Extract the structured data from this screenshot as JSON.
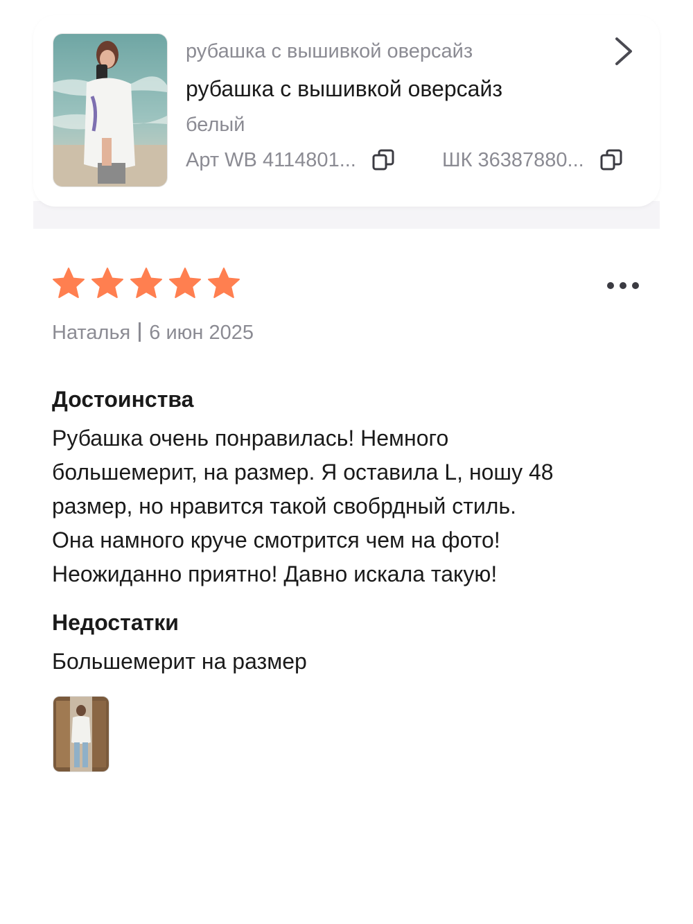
{
  "product": {
    "brand": "рубашка с вышивкой оверсайз",
    "name": "рубашка с вышивкой оверсайз",
    "color": "белый",
    "article": "Арт WB 4114801...",
    "barcode": "ШК 36387880...",
    "thumbnail_icon": "product-photo"
  },
  "review": {
    "rating": 5,
    "rating_max": 5,
    "star_color": "#ff7f50",
    "author": "Наталья",
    "date": "6 июн 2025",
    "pros_title": "Достоинства",
    "pros_lines": [
      "Рубашка очень понравилась! Немного",
      "большемерит, на размер. Я оставила L, ношу 48",
      "размер, но нравится такой свобрдный стиль.",
      "Она намного круче смотрится чем на фото!",
      "Неожиданно приятно! Давно искала такую!"
    ],
    "cons_title": "Недостатки",
    "cons_text": "Большемерит на размер",
    "photo_icon": "review-photo"
  },
  "icons": {
    "chevron": "chevron-right-icon",
    "copy": "copy-icon",
    "more": "more-dots-icon",
    "star": "star-icon"
  }
}
